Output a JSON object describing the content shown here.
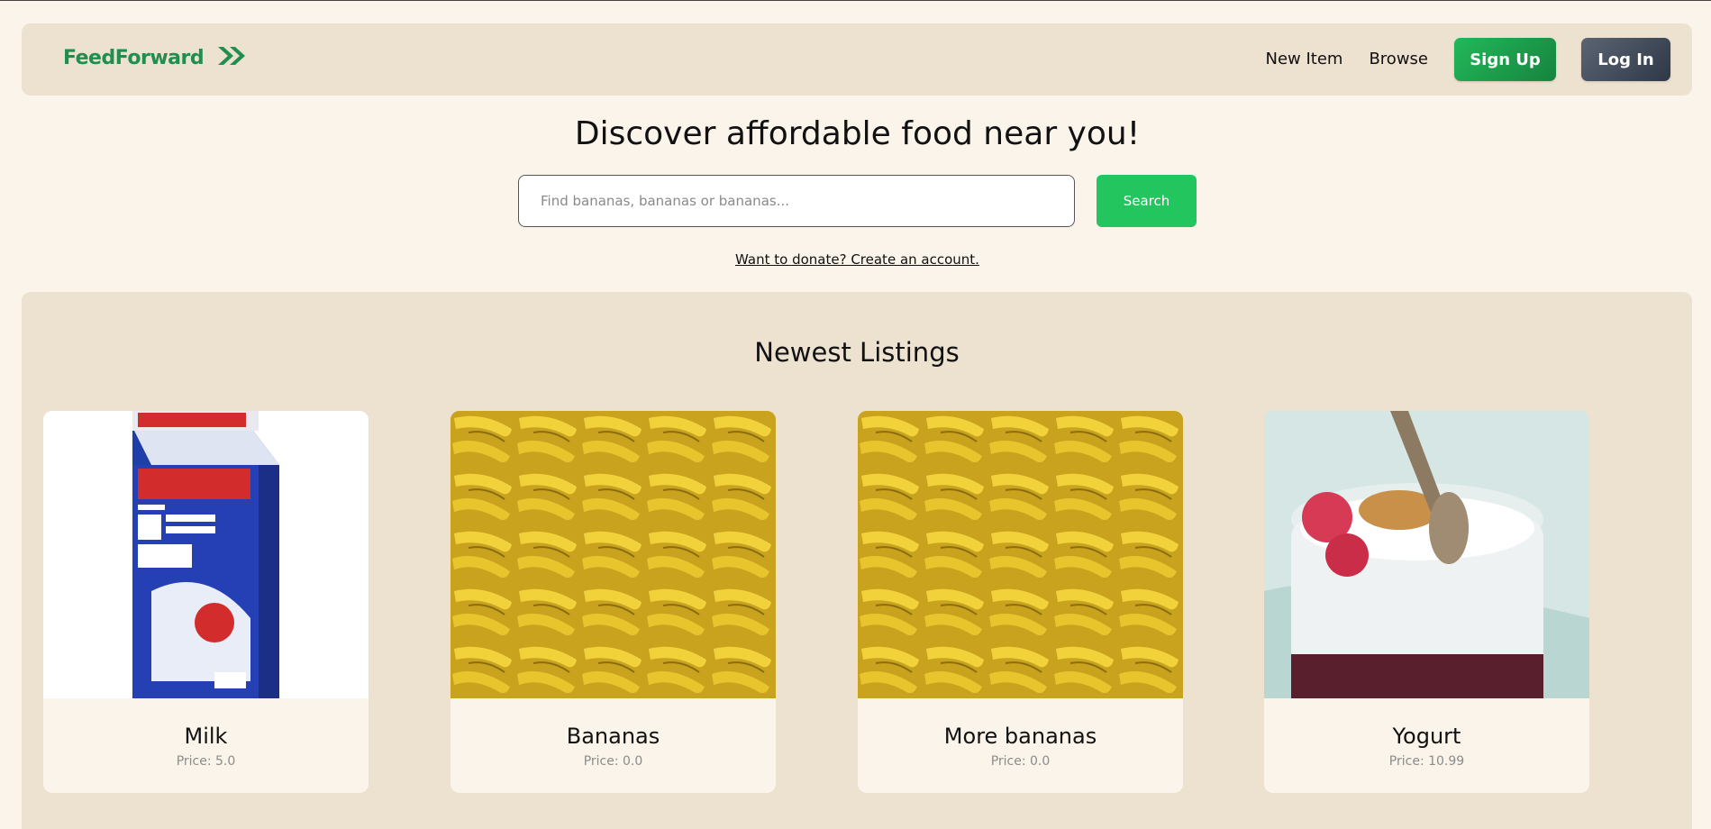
{
  "nav": {
    "brand": "FeedForward",
    "links": [
      "New Item",
      "Browse"
    ],
    "signup_label": "Sign Up",
    "login_label": "Log In"
  },
  "hero": {
    "title": "Discover affordable food near you!",
    "search_placeholder": "Find bananas, bananas or bananas...",
    "search_button": "Search",
    "donate_link": "Want to donate? Create an account."
  },
  "listings": {
    "title": "Newest Listings",
    "items": [
      {
        "name": "Milk",
        "price": "Price: 5.0"
      },
      {
        "name": "Bananas",
        "price": "Price: 0.0"
      },
      {
        "name": "More bananas",
        "price": "Price: 0.0"
      },
      {
        "name": "Yogurt",
        "price": "Price: 10.99"
      }
    ]
  },
  "colors": {
    "page_bg": "#fbf4ea",
    "panel_bg": "#ede1d0",
    "brand_green": "#1f8f4e",
    "search_green": "#22c55e",
    "login_gray": "#3a4352"
  }
}
